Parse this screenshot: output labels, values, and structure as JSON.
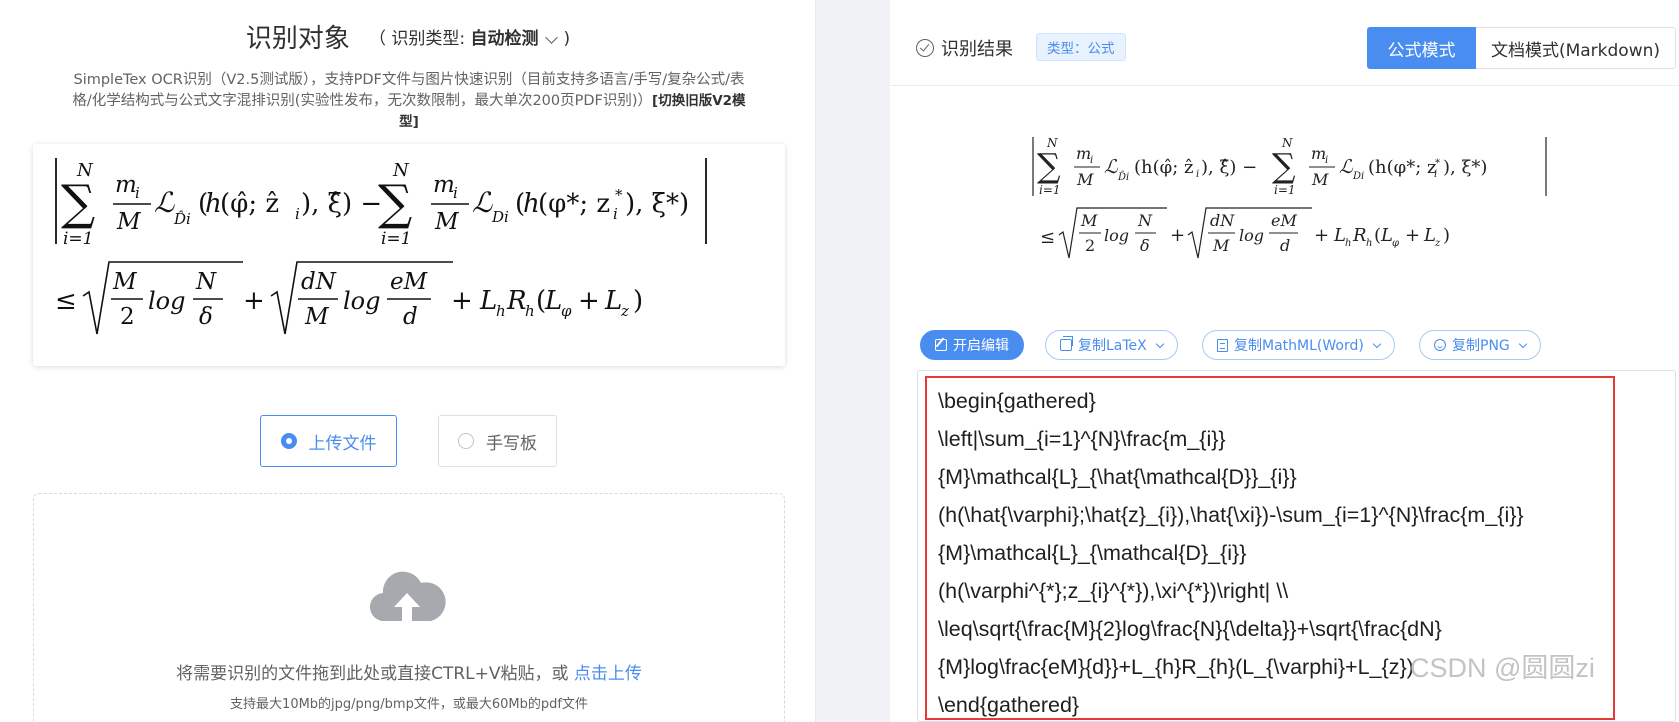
{
  "left": {
    "title": "识别对象",
    "type_prefix": "（ 识别类型:",
    "type_value": "自动检测",
    "type_suffix": ")",
    "description_lines": [
      "SimpleTex OCR识别（V2.5测试版），支持PDF文件与图片快速识别（目前支持多语言/手写/复杂公式/表",
      "格/化学结构式与公式文字混排识别(实验性发布，无次数限制，最大单次200页PDF识别)）",
      "型]"
    ],
    "switch_link": "[切换旧版V2模",
    "mode_upload": "上传文件",
    "mode_handwrite": "手写板",
    "drop_text": "将需要识别的文件拖到此处或直接CTRL+V粘贴，或",
    "drop_link": "点击上传",
    "drop_sub": "支持最大10Mb的jpg/png/bmp文件，或最大60Mb的pdf文件"
  },
  "right": {
    "result_title": "识别结果",
    "type_badge": "类型：公式",
    "tab_formula": "公式模式",
    "tab_doc": "文档模式(Markdown)",
    "btn_edit": "开启编辑",
    "btn_latex": "复制LaTeX",
    "btn_mathml": "复制MathML(Word)",
    "btn_png": "复制PNG",
    "code_lines": [
      "\\begin{gathered}",
      "\\left|\\sum_{i=1}^{N}\\frac{m_{i}}",
      "{M}\\mathcal{L}_{\\hat{\\mathcal{D}}_{i}}",
      "(h(\\hat{\\varphi};\\hat{z}_{i}),\\hat{\\xi})-\\sum_{i=1}^{N}\\frac{m_{i}}",
      "{M}\\mathcal{L}_{\\mathcal{D}_{i}}",
      "(h(\\varphi^{*};z_{i}^{*}),\\xi^{*})\\right| \\\\",
      "\\leq\\sqrt{\\frac{M}{2}log\\frac{N}{\\delta}}+\\sqrt{\\frac{dN}",
      "{M}log\\frac{eM}{d}}+L_{h}R_{h}(L_{\\varphi}+L_{z})",
      "\\end{gathered}"
    ]
  },
  "watermark": "CSDN @圆圆zi",
  "icons": {
    "cloud": "upload-cloud-icon",
    "check": "check-circle-icon",
    "edit": "edit-icon",
    "copy": "copy-icon",
    "doc": "document-icon",
    "image": "image-icon",
    "chevron": "chevron-down-icon"
  },
  "colors": {
    "accent": "#4a8df0",
    "highlight_border": "#e53935"
  }
}
